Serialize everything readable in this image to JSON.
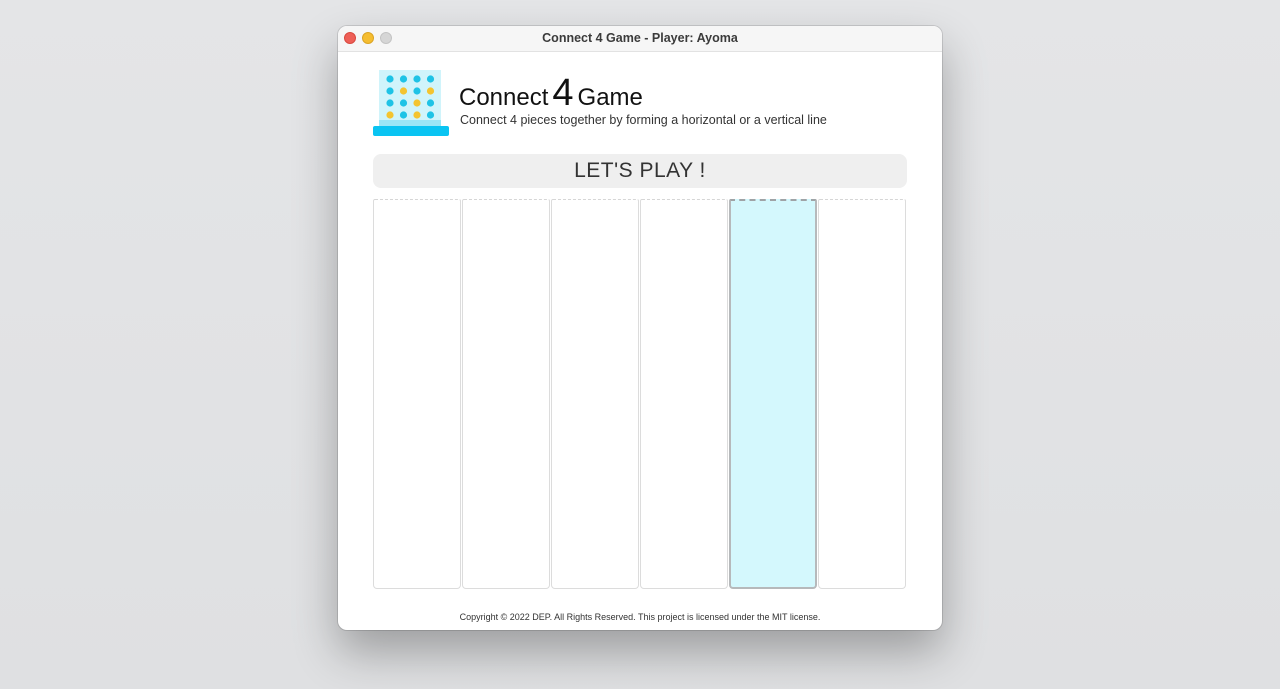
{
  "window": {
    "title": "Connect 4 Game - Player: Ayoma"
  },
  "header": {
    "logo_icon": "connect-four-board-icon",
    "title_prefix": "Connect",
    "title_number": "4",
    "title_suffix": "Game",
    "subtitle": "Connect 4 pieces together by forming a horizontal or a vertical line"
  },
  "banner": {
    "text": "LET'S PLAY !"
  },
  "board": {
    "columns": 6,
    "highlighted_column": 5
  },
  "footer": {
    "copyright": "Copyright © 2022 DEP. All Rights Reserved. This project is licensed under the MIT license."
  },
  "colors": {
    "highlight": "#d4f8fd",
    "piece_cyan": "#1ec3e6",
    "piece_yellow": "#f4c430",
    "logo_base": "#0ac4f2"
  }
}
